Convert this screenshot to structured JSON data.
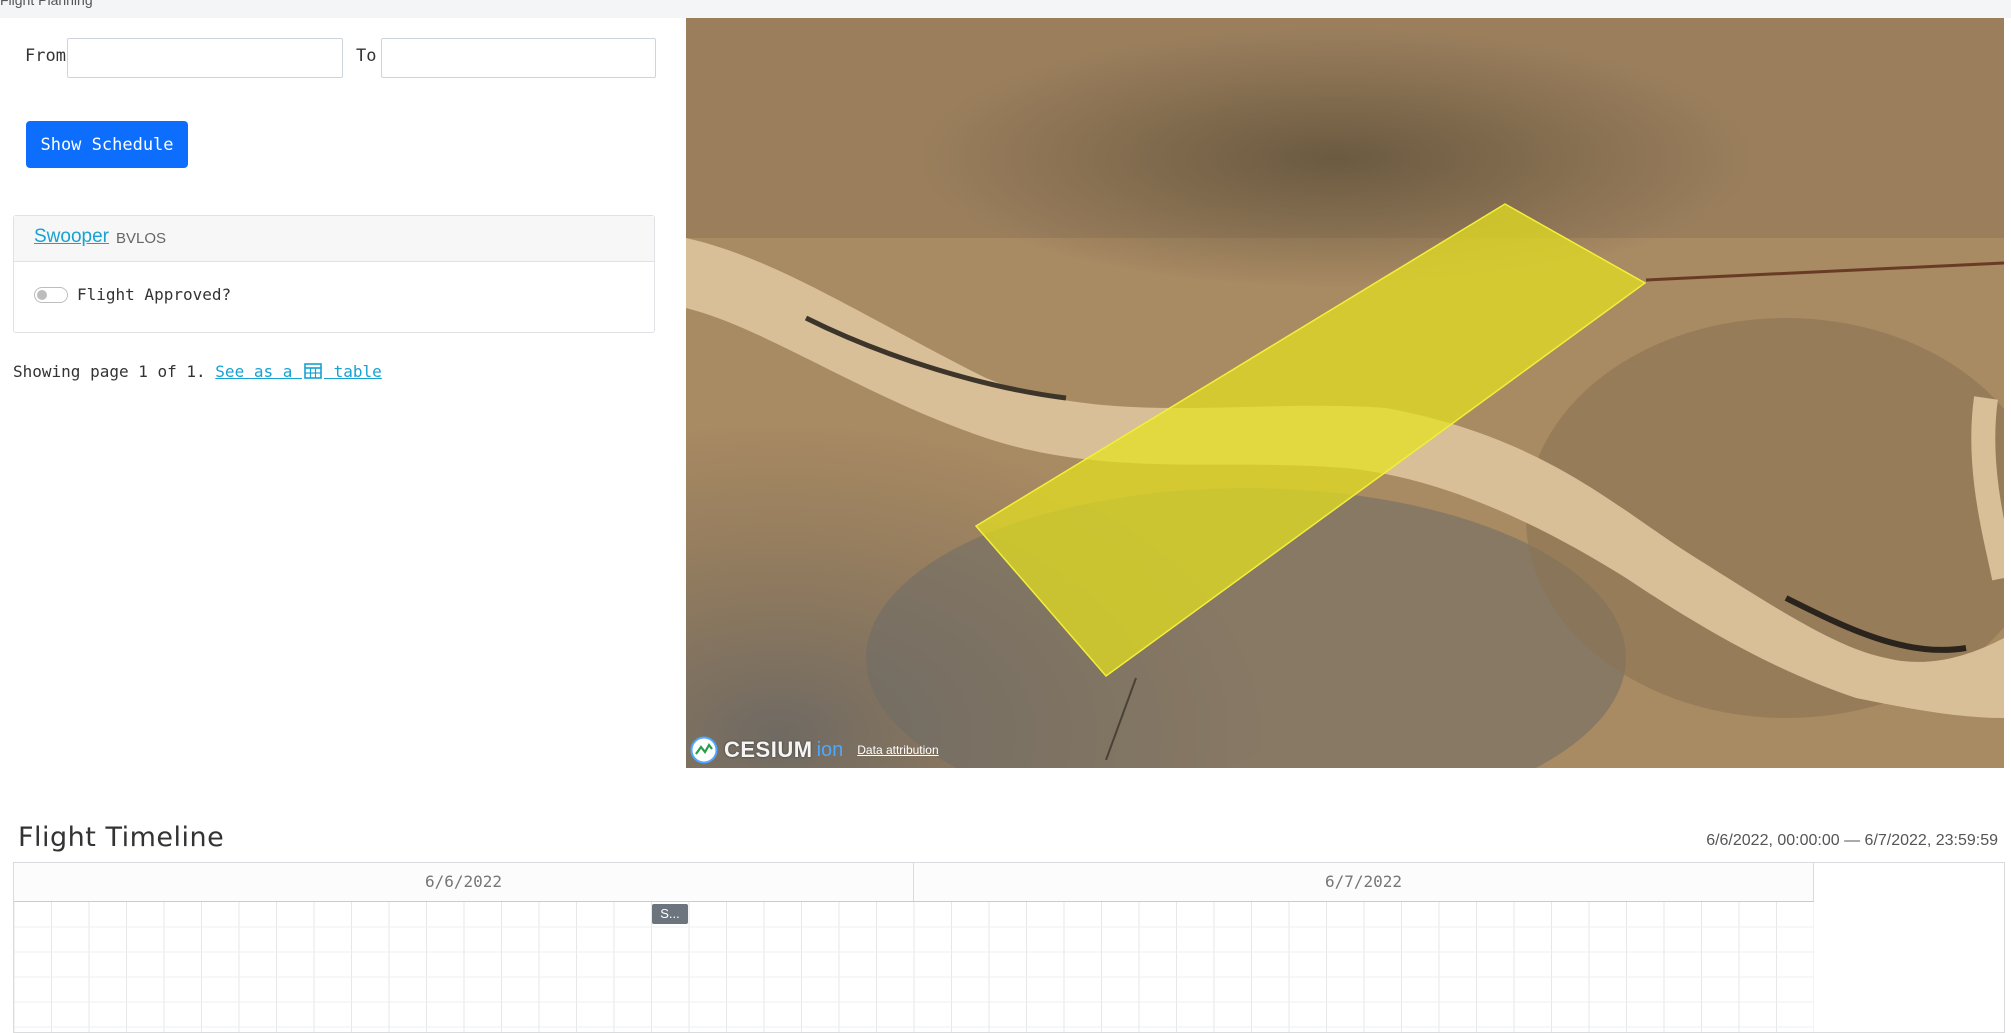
{
  "header": {
    "cut_text": "Flight Planning"
  },
  "filters": {
    "from_label": "From",
    "from_value": "",
    "to_label": "To",
    "to_value": "",
    "show_schedule_label": "Show Schedule"
  },
  "card": {
    "title": "Swooper",
    "subtitle": "BVLOS",
    "approved_label": "Flight Approved?",
    "approved": false
  },
  "paging": {
    "text": "Showing page 1 of 1.",
    "link_prefix": "See as a",
    "link_suffix": "table"
  },
  "map": {
    "logo_text": "CESIUM",
    "logo_sub": "ion",
    "attribution": "Data attribution",
    "area_color": "#e6e21e",
    "icon": "cesium-logo-icon"
  },
  "timeline": {
    "title": "Flight Timeline",
    "range_start": "6/6/2022, 00:00:00",
    "range_sep": "—",
    "range_end": "6/7/2022, 23:59:59",
    "days": [
      "6/6/2022",
      "6/7/2022"
    ],
    "item_label": "S..."
  }
}
